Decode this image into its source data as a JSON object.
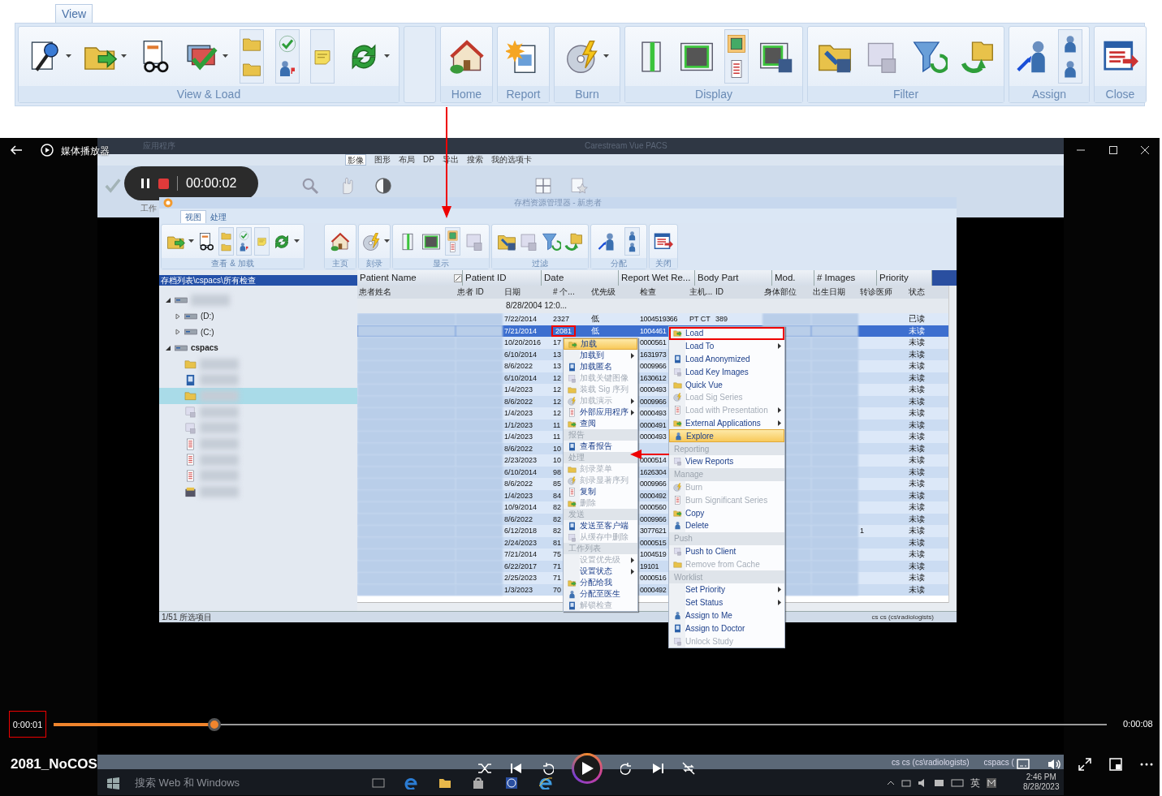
{
  "ribbon": {
    "tab": {
      "label": "View",
      "selected": true
    },
    "groups": [
      {
        "kind": "group",
        "label": "View & Load"
      },
      {
        "kind": "spacer"
      },
      {
        "kind": "group",
        "label": "Home"
      },
      {
        "kind": "group",
        "label": "Report"
      },
      {
        "kind": "group",
        "label": "Burn"
      },
      {
        "kind": "group",
        "label": "Display"
      },
      {
        "kind": "group",
        "label": "Filter"
      },
      {
        "kind": "group",
        "label": "Assign"
      },
      {
        "kind": "group",
        "label": "Close"
      }
    ]
  },
  "player": {
    "title": "媒体播放器",
    "recording": {
      "elapsed": "00:00:02"
    },
    "position": {
      "text": "0:00:01",
      "outlined": true
    },
    "duration": "0:00:08",
    "progress": {
      "level": 0.153
    },
    "media_title": "2081_NoCOS"
  },
  "background_app": {
    "title": "Carestream Vue PACS",
    "app_menu": "应用程序",
    "tabs": [
      {
        "label": "影像",
        "selected": true
      },
      {
        "label": "图形",
        "selected": false
      },
      {
        "label": "布局",
        "selected": false
      },
      {
        "label": "DP",
        "selected": false
      },
      {
        "label": "导出",
        "selected": false
      },
      {
        "label": "搜索",
        "selected": false
      },
      {
        "label": "我的选项卡",
        "selected": false
      }
    ],
    "group_label": "工作"
  },
  "dialog": {
    "title": "存档资源管理器 - 新患者",
    "tabs": [
      {
        "label": "视图",
        "selected": true
      },
      {
        "label": "处理",
        "selected": false
      }
    ],
    "groups": [
      "查看 & 加载",
      "主页",
      "刻录",
      "显示",
      "过滤",
      "分配",
      "关闭"
    ],
    "path": "存档列表\\cspacs\\所有检查",
    "tree": [
      {
        "expanded": true,
        "children": [
          {
            "label": "(D:)",
            "expanded": false
          },
          {
            "label": "(C:)",
            "expanded": false
          }
        ]
      },
      {
        "label": "cspacs",
        "expanded": true,
        "children": [
          {
            "kind": "folder",
            "selected": false
          },
          {
            "kind": "image",
            "selected": false
          },
          {
            "kind": "folder",
            "selected": true
          },
          {
            "kind": "document",
            "selected": false
          },
          {
            "kind": "document",
            "selected": false
          },
          {
            "kind": "list",
            "selected": false
          },
          {
            "kind": "list",
            "selected": false
          },
          {
            "kind": "list",
            "selected": false
          },
          {
            "kind": "box",
            "selected": false
          }
        ]
      }
    ],
    "column_chooser": [
      "Patient Name",
      "Patient ID",
      "Date",
      "Report Wet Re...",
      "Body Part",
      "Mod.",
      "# Images",
      "Priority"
    ],
    "table": {
      "columns": [
        "患者姓名",
        "患者 ID",
        "日期",
        "# 个...",
        "优先级",
        "检查",
        "主机...",
        "ID",
        "身体部位",
        "出生日期",
        "转诊医师",
        "状态"
      ],
      "filter": "8/28/2004 12:0...",
      "rows": [
        {
          "date": "7/22/2014",
          "count": "2327",
          "priority": "低",
          "exam": "1004519366",
          "host": "PT CT",
          "id": "389",
          "status": "已读",
          "selected": false
        },
        {
          "date": "7/21/2014",
          "count": "2081",
          "priority": "低",
          "exam": "1004461",
          "status": "未读",
          "selected": true,
          "outlined": true
        },
        {
          "date": "10/20/2016",
          "count": "17",
          "exam": "0000561",
          "status": "未读",
          "selected": false
        },
        {
          "date": "6/10/2014",
          "count": "13",
          "exam": "1631973",
          "status": "未读",
          "selected": false
        },
        {
          "date": "8/6/2022",
          "count": "13",
          "exam": "0009966",
          "status": "未读",
          "selected": false
        },
        {
          "date": "6/10/2014",
          "count": "12",
          "exam": "1630612",
          "status": "未读",
          "selected": false
        },
        {
          "date": "1/4/2023",
          "count": "12",
          "exam": "0000493",
          "status": "未读",
          "selected": false
        },
        {
          "date": "8/6/2022",
          "count": "12",
          "exam": "0009966",
          "status": "未读",
          "selected": false
        },
        {
          "date": "1/4/2023",
          "count": "12",
          "exam": "0000493",
          "status": "未读",
          "selected": false
        },
        {
          "date": "1/1/2023",
          "count": "11",
          "exam": "0000491",
          "status": "未读",
          "selected": false
        },
        {
          "date": "1/4/2023",
          "count": "11",
          "exam": "0000493",
          "status": "未读",
          "selected": false
        },
        {
          "date": "8/6/2022",
          "count": "10",
          "status": "未读",
          "selected": false
        },
        {
          "date": "2/23/2023",
          "count": "10",
          "exam": "0000514",
          "status": "未读",
          "selected": false
        },
        {
          "date": "6/10/2014",
          "count": "98",
          "exam": "1626304",
          "status": "未读",
          "selected": false
        },
        {
          "date": "8/6/2022",
          "count": "85",
          "exam": "0009966",
          "status": "未读",
          "selected": false
        },
        {
          "date": "1/4/2023",
          "count": "84",
          "exam": "0000492",
          "status": "未读",
          "selected": false
        },
        {
          "date": "10/9/2014",
          "count": "82",
          "exam": "0000560",
          "status": "未读",
          "selected": false
        },
        {
          "date": "8/6/2022",
          "count": "82",
          "exam": "0009966",
          "status": "未读",
          "selected": false
        },
        {
          "date": "6/12/2018",
          "count": "82",
          "exam": "3077621",
          "referring": "1",
          "status": "未读",
          "selected": false
        },
        {
          "date": "2/24/2023",
          "count": "81",
          "exam": "0000515",
          "status": "未读",
          "selected": false
        },
        {
          "date": "7/21/2014",
          "count": "75",
          "exam": "1004519",
          "status": "未读",
          "selected": false
        },
        {
          "date": "6/22/2017",
          "count": "71",
          "exam": "19101",
          "status": "未读",
          "selected": false
        },
        {
          "date": "2/25/2023",
          "count": "71",
          "exam": "0000516",
          "status": "未读",
          "selected": false
        },
        {
          "date": "1/3/2023",
          "count": "70",
          "exam": "0000492",
          "status": "未读",
          "selected": false
        }
      ]
    },
    "status": "1/51 所选项目",
    "user": "cs cs (cs\\radiologists)"
  },
  "menus": [
    {
      "items": [
        {
          "kind": "item",
          "label": "加载",
          "selected": true,
          "disabled": false
        },
        {
          "kind": "item",
          "label": "加载到",
          "submenu": true,
          "selected": false,
          "disabled": false
        },
        {
          "kind": "item",
          "label": "加载匿名",
          "selected": false,
          "disabled": false
        },
        {
          "kind": "item",
          "label": "加载关键图像",
          "selected": false,
          "disabled": true
        },
        {
          "kind": "item",
          "label": "装载 Sig 序列",
          "selected": false,
          "disabled": true
        },
        {
          "kind": "item",
          "label": "加载演示",
          "submenu": true,
          "selected": false,
          "disabled": true
        },
        {
          "kind": "item",
          "label": "外部应用程序",
          "submenu": true,
          "selected": false,
          "disabled": false
        },
        {
          "kind": "item",
          "label": "查阅",
          "selected": false,
          "disabled": false
        },
        {
          "kind": "header",
          "label": "报告"
        },
        {
          "kind": "item",
          "label": "查看报告",
          "selected": false,
          "disabled": false
        },
        {
          "kind": "header",
          "label": "处理"
        },
        {
          "kind": "item",
          "label": "刻录菜单",
          "selected": false,
          "disabled": true
        },
        {
          "kind": "item",
          "label": "刻录显著序列",
          "selected": false,
          "disabled": true
        },
        {
          "kind": "item",
          "label": "复制",
          "selected": false,
          "disabled": false
        },
        {
          "kind": "item",
          "label": "删除",
          "selected": false,
          "disabled": true
        },
        {
          "kind": "header",
          "label": "发送"
        },
        {
          "kind": "item",
          "label": "发送至客户端",
          "selected": false,
          "disabled": false
        },
        {
          "kind": "item",
          "label": "从缓存中删除",
          "selected": false,
          "disabled": true
        },
        {
          "kind": "header",
          "label": "工作列表"
        },
        {
          "kind": "item",
          "label": "设置优先级",
          "submenu": true,
          "selected": false,
          "disabled": true
        },
        {
          "kind": "item",
          "label": "设置状态",
          "submenu": true,
          "selected": false,
          "disabled": false
        },
        {
          "kind": "item",
          "label": "分配给我",
          "selected": false,
          "disabled": false
        },
        {
          "kind": "item",
          "label": "分配至医生",
          "selected": false,
          "disabled": false
        },
        {
          "kind": "item",
          "label": "解锁检查",
          "selected": false,
          "disabled": true
        }
      ]
    },
    {
      "items": [
        {
          "kind": "item",
          "label": "Load",
          "selected": false,
          "disabled": false,
          "outlined": true
        },
        {
          "kind": "item",
          "label": "Load To",
          "submenu": true,
          "selected": false,
          "disabled": false
        },
        {
          "kind": "item",
          "label": "Load Anonymized",
          "selected": false,
          "disabled": false
        },
        {
          "kind": "item",
          "label": "Load Key Images",
          "selected": false,
          "disabled": false
        },
        {
          "kind": "item",
          "label": "Quick Vue",
          "selected": false,
          "disabled": false
        },
        {
          "kind": "item",
          "label": "Load Sig Series",
          "selected": false,
          "disabled": true
        },
        {
          "kind": "item",
          "label": "Load with Presentation",
          "submenu": true,
          "selected": false,
          "disabled": true
        },
        {
          "kind": "item",
          "label": "External Applications",
          "submenu": true,
          "selected": false,
          "disabled": false
        },
        {
          "kind": "item",
          "label": "Explore",
          "selected": true,
          "disabled": false
        },
        {
          "kind": "header",
          "label": "Reporting"
        },
        {
          "kind": "item",
          "label": "View Reports",
          "selected": false,
          "disabled": false
        },
        {
          "kind": "header",
          "label": "Manage"
        },
        {
          "kind": "item",
          "label": "Burn",
          "selected": false,
          "disabled": true
        },
        {
          "kind": "item",
          "label": "Burn Significant Series",
          "selected": false,
          "disabled": true
        },
        {
          "kind": "item",
          "label": "Copy",
          "selected": false,
          "disabled": false
        },
        {
          "kind": "item",
          "label": "Delete",
          "selected": false,
          "disabled": false
        },
        {
          "kind": "header",
          "label": "Push"
        },
        {
          "kind": "item",
          "label": "Push to Client",
          "selected": false,
          "disabled": false
        },
        {
          "kind": "item",
          "label": "Remove from Cache",
          "selected": false,
          "disabled": true
        },
        {
          "kind": "header",
          "label": "Worklist"
        },
        {
          "kind": "item",
          "label": "Set Priority",
          "submenu": true,
          "selected": false,
          "disabled": false
        },
        {
          "kind": "item",
          "label": "Set Status",
          "submenu": true,
          "selected": false,
          "disabled": false
        },
        {
          "kind": "item",
          "label": "Assign to Me",
          "selected": false,
          "disabled": false
        },
        {
          "kind": "item",
          "label": "Assign to Doctor",
          "selected": false,
          "disabled": false
        },
        {
          "kind": "item",
          "label": "Unlock Study",
          "selected": false,
          "disabled": true
        }
      ]
    }
  ],
  "taskbar": {
    "status": [
      "cs cs (cs\\radiologists)",
      "cspacs ("
    ],
    "search": {
      "placeholder": "搜索 Web 和 Windows"
    },
    "ime": "英",
    "time": "2:46 PM",
    "date": "8/28/2023"
  }
}
